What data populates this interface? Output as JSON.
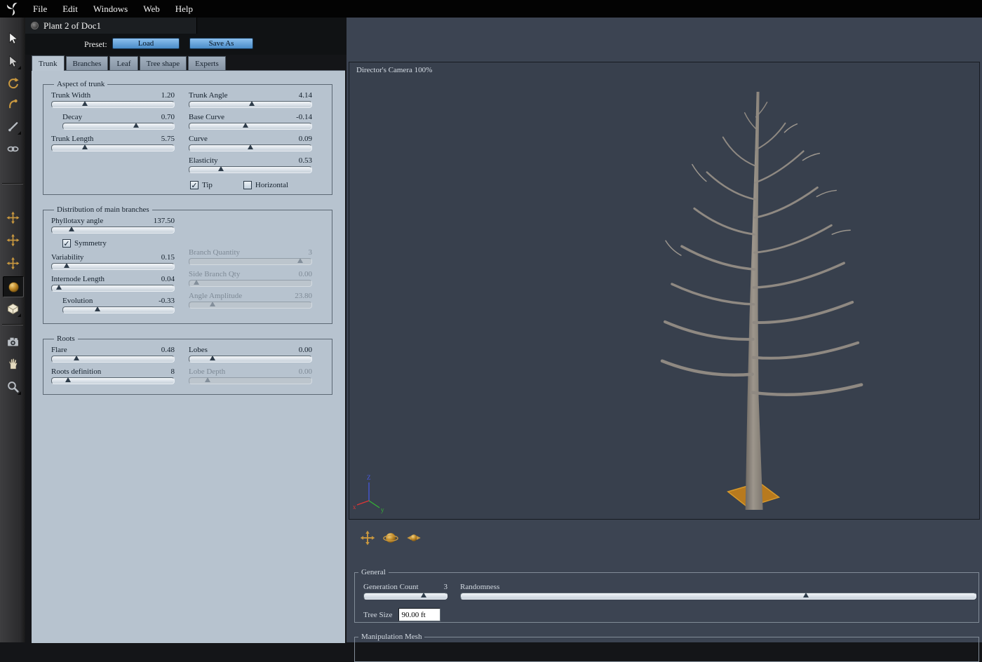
{
  "menubar": {
    "items": [
      "File",
      "Edit",
      "Windows",
      "Web",
      "Help"
    ]
  },
  "titlebar": {
    "title": "Plant 2 of Doc1"
  },
  "preset": {
    "label": "Preset:",
    "load_button": "Load",
    "save_as_button": "Save As"
  },
  "tabs": {
    "items": [
      "Trunk",
      "Branches",
      "Leaf",
      "Tree shape",
      "Experts"
    ],
    "active": "Trunk"
  },
  "panel": {
    "groups": [
      {
        "title": "Aspect of trunk",
        "left": [
          {
            "label": "Trunk Width",
            "value": "1.20",
            "pos": 27
          },
          {
            "label": "Decay",
            "value": "0.70",
            "pos": 66,
            "indent": true
          },
          {
            "label": "Trunk Length",
            "value": "5.75",
            "pos": 27
          }
        ],
        "right": [
          {
            "label": "Trunk Angle",
            "value": "4.14",
            "pos": 51
          },
          {
            "label": "Base Curve",
            "value": "-0.14",
            "pos": 46
          },
          {
            "label": "Curve",
            "value": "0.09",
            "pos": 50
          },
          {
            "label": "Elasticity",
            "value": "0.53",
            "pos": 26
          }
        ],
        "checkboxes": [
          {
            "label": "Tip",
            "checked": true
          },
          {
            "label": "Horizontal",
            "checked": false
          }
        ]
      },
      {
        "title": "Distribution of main branches",
        "right_offset": true,
        "left": [
          {
            "label": "Phyllotaxy angle",
            "value": "137.50",
            "pos": 16
          },
          {
            "type": "checkbox",
            "label": "Symmetry",
            "checked": true
          },
          {
            "label": "Variability",
            "value": "0.15",
            "pos": 12
          },
          {
            "label": "Internode Length",
            "value": "0.04",
            "pos": 6
          },
          {
            "label": "Evolution",
            "value": "-0.33",
            "pos": 31,
            "indent": true
          }
        ],
        "right": [
          {
            "label": "Branch Quantity",
            "value": "3",
            "pos": 91,
            "disabled": true
          },
          {
            "label": "Side Branch Qty",
            "value": "0.00",
            "pos": 6,
            "disabled": true
          },
          {
            "label": "Angle Amplitude",
            "value": "23.80",
            "pos": 19,
            "disabled": true
          }
        ]
      },
      {
        "title": "Roots",
        "left": [
          {
            "label": "Flare",
            "value": "0.48",
            "pos": 20
          },
          {
            "label": "Roots definition",
            "value": "8",
            "pos": 13
          }
        ],
        "right": [
          {
            "label": "Lobes",
            "value": "0.00",
            "pos": 19
          },
          {
            "label": "Lobe Depth",
            "value": "0.00",
            "pos": 15,
            "disabled": true
          }
        ]
      }
    ]
  },
  "viewport": {
    "camera_label": "Director's Camera 100%",
    "axis_labels": {
      "x": "x",
      "y": "y",
      "z": "Z"
    },
    "nav_tools": [
      {
        "name": "camera-pan-tool",
        "icon": "cross"
      },
      {
        "name": "camera-trackball-tool",
        "icon": "trackball"
      },
      {
        "name": "camera-orbit-tool",
        "icon": "orbit"
      }
    ]
  },
  "general": {
    "title": "General",
    "generation_count": {
      "label": "Generation Count",
      "value": "3",
      "pos": 72
    },
    "randomness": {
      "label": "Randomness",
      "value": "",
      "pos": 67
    },
    "tree_size": {
      "label": "Tree Size",
      "value": "90.00 ft"
    }
  },
  "manipulation": {
    "title": "Manipulation Mesh"
  },
  "toolbar": {
    "tools": [
      {
        "name": "select-tool",
        "icon": "cursor"
      },
      {
        "name": "direct-select-tool",
        "icon": "cursor"
      },
      {
        "name": "rotate-view-tool",
        "icon": "rotate"
      },
      {
        "name": "bend-tool",
        "icon": "hook"
      },
      {
        "name": "draw-line-tool",
        "icon": "diag"
      },
      {
        "name": "link-tool",
        "icon": "link"
      },
      {
        "name": "move-tool",
        "icon": "cross"
      },
      {
        "name": "move-plane-tool",
        "icon": "cross"
      },
      {
        "name": "move-axis-tool",
        "icon": "cross"
      },
      {
        "name": "universal-manipulator-tool",
        "icon": "sphere"
      },
      {
        "name": "reference-plane-tool",
        "icon": "cube"
      },
      {
        "name": "camera-tool",
        "icon": "camera"
      },
      {
        "name": "pan-tool",
        "icon": "hand"
      },
      {
        "name": "zoom-tool",
        "icon": "magnifier"
      }
    ]
  },
  "colors": {
    "accent_blue": "#5b9bd5",
    "panel": "#b7c3cf",
    "viewport": "#38404d",
    "base_orange": "#b87a1e",
    "tool_gold": "#c9983f"
  }
}
